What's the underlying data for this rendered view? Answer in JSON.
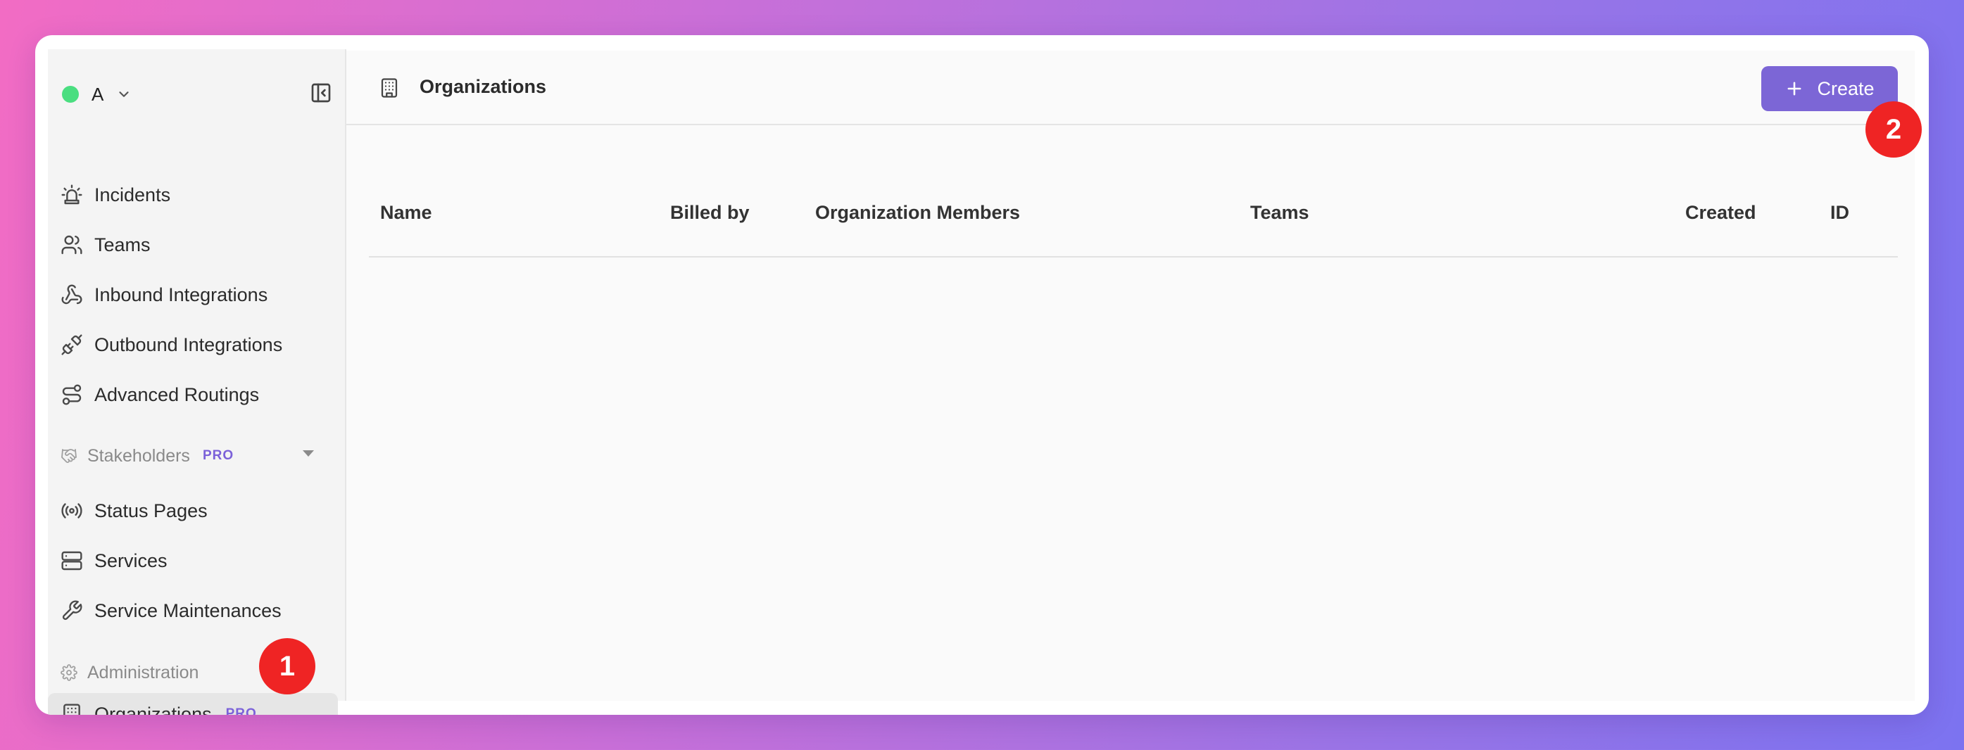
{
  "workspace": {
    "name": "A",
    "status_color": "#4ade80"
  },
  "sidebar": {
    "items": [
      {
        "label": "Incidents"
      },
      {
        "label": "Teams"
      },
      {
        "label": "Inbound Integrations"
      },
      {
        "label": "Outbound Integrations"
      },
      {
        "label": "Advanced Routings"
      }
    ],
    "stakeholders": {
      "label": "Stakeholders",
      "badge": "PRO",
      "items": [
        {
          "label": "Status Pages"
        },
        {
          "label": "Services"
        },
        {
          "label": "Service Maintenances"
        }
      ]
    },
    "administration": {
      "label": "Administration",
      "items": [
        {
          "label": "Organizations",
          "badge": "PRO",
          "active": true
        }
      ]
    }
  },
  "header": {
    "title": "Organizations",
    "create_label": "Create"
  },
  "table": {
    "columns": [
      "Name",
      "Billed by",
      "Organization Members",
      "Teams",
      "Created",
      "ID"
    ],
    "rows": []
  },
  "annotations": {
    "step1": "1",
    "step2": "2"
  },
  "colors": {
    "accent": "#7c66d6",
    "badge": "#ef2424",
    "pro": "#7b61d9"
  }
}
